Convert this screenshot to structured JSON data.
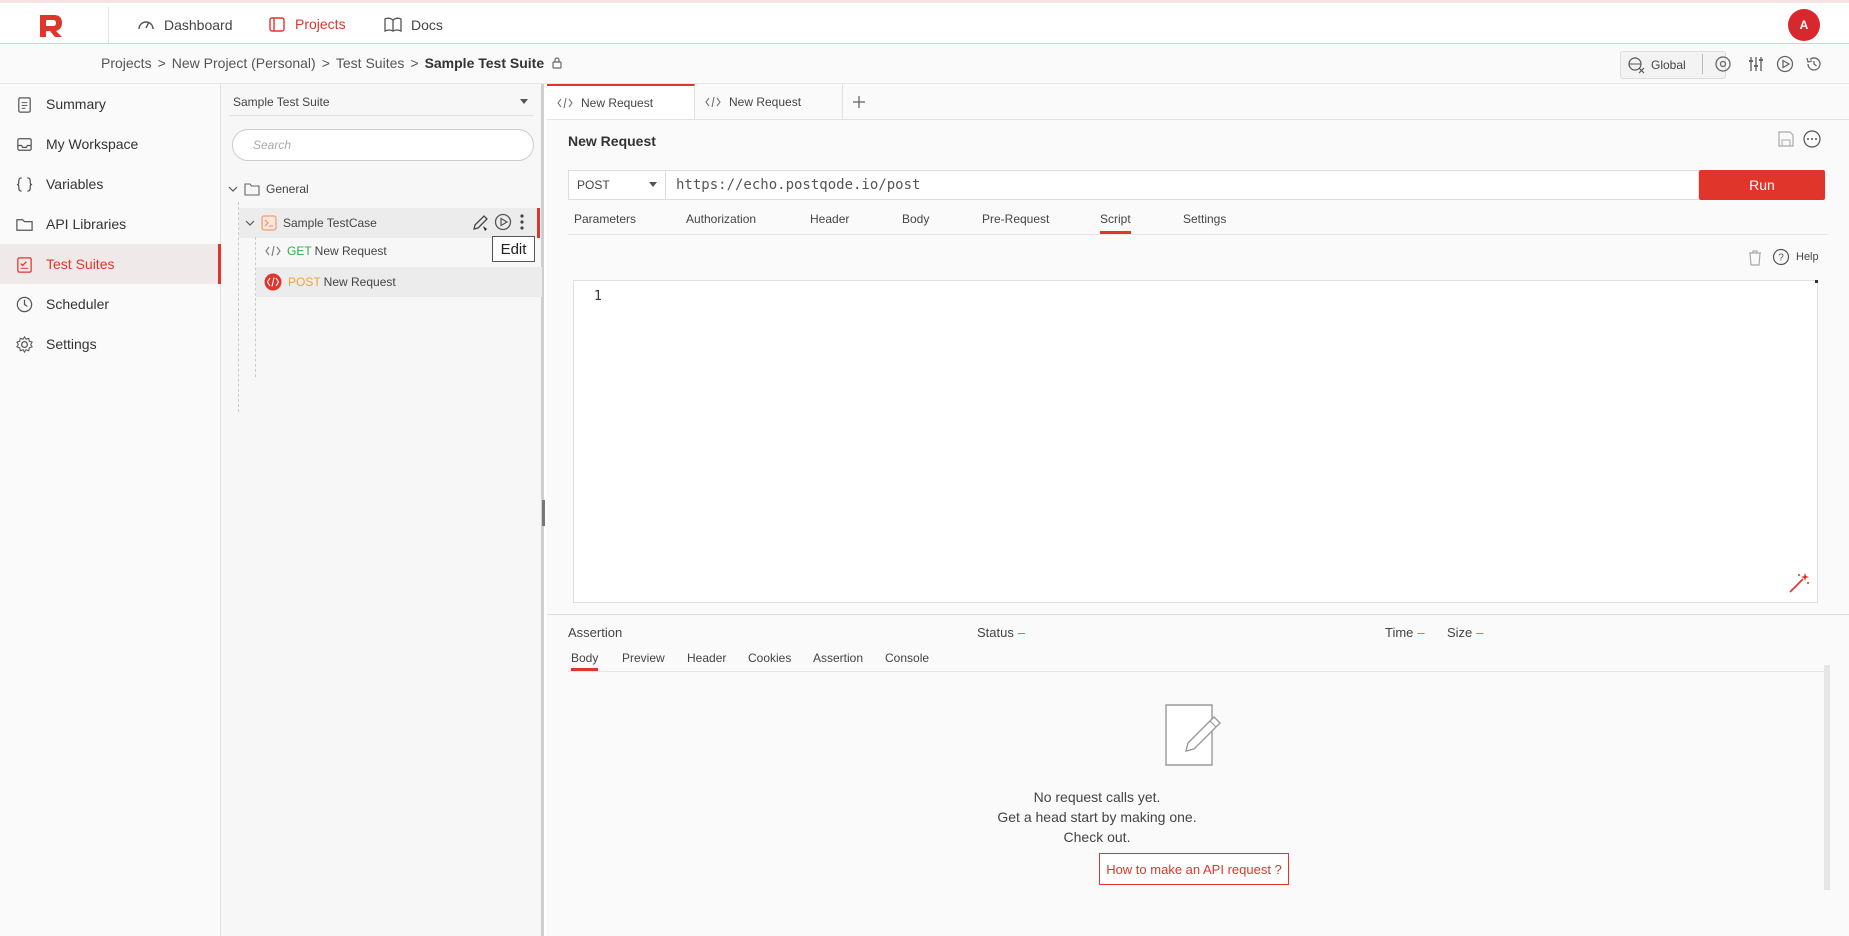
{
  "topnav": {
    "dashboard": "Dashboard",
    "projects": "Projects",
    "docs": "Docs",
    "avatar_initial": "A"
  },
  "breadcrumb": {
    "projects": "Projects",
    "project": "New Project (Personal)",
    "suites": "Test Suites",
    "current": "Sample Test Suite",
    "sep": ">"
  },
  "env": {
    "label": "Global"
  },
  "sidebar": {
    "items": [
      {
        "label": "Summary",
        "icon": "clipboard-icon"
      },
      {
        "label": "My Workspace",
        "icon": "inbox-icon"
      },
      {
        "label": "Variables",
        "icon": "braces-icon"
      },
      {
        "label": "API Libraries",
        "icon": "folder-icon"
      },
      {
        "label": "Test Suites",
        "icon": "checklist-icon"
      },
      {
        "label": "Scheduler",
        "icon": "clock-icon"
      },
      {
        "label": "Settings",
        "icon": "gear-icon"
      }
    ]
  },
  "tree": {
    "suite_select": "Sample Test Suite",
    "search_placeholder": "Search",
    "folder": "General",
    "testcase": "Sample TestCase",
    "req1_method": "GET",
    "req1_name": "New Request",
    "req2_method": "POST",
    "req2_name": "New Request",
    "tooltip": "Edit"
  },
  "main": {
    "tabs": [
      "New Request",
      "New Request"
    ],
    "title": "New Request",
    "method": "POST",
    "url": "https://echo.postqode.io/post",
    "run": "Run",
    "subtabs": [
      "Parameters",
      "Authorization",
      "Header",
      "Body",
      "Pre-Request",
      "Script",
      "Settings"
    ],
    "help": "Help",
    "line_number": "1"
  },
  "response": {
    "assertion": "Assertion",
    "status": "Status",
    "time": "Time",
    "size": "Size",
    "dash": "–",
    "tabs": [
      "Body",
      "Preview",
      "Header",
      "Cookies",
      "Assertion",
      "Console"
    ],
    "empty_line1": "No request calls yet.",
    "empty_line2": "Get a head start by making one.",
    "empty_line3": "Check out.",
    "how_button": "How to make an API request ?"
  },
  "colors": {
    "accent": "#e0352b",
    "get": "#2bb14a",
    "post": "#f0a33a"
  }
}
